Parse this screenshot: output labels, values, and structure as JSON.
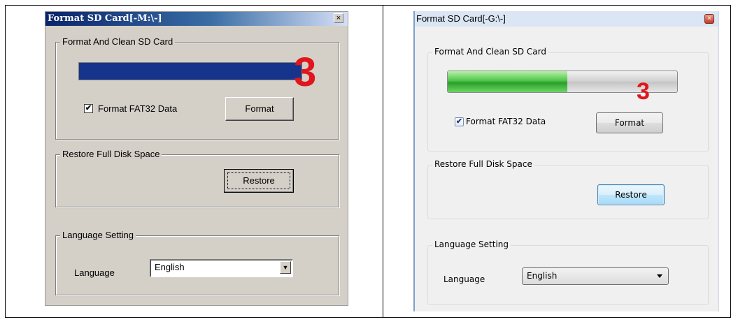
{
  "left_window": {
    "title": "Format SD Card[-M:\\-]",
    "close_glyph": "×",
    "format_group": {
      "legend": "Format And Clean SD Card",
      "progress": 1.0,
      "step_number": "3",
      "checkbox_checked": true,
      "checkbox_label": "Format FAT32 Data",
      "format_button": "Format"
    },
    "restore_group": {
      "legend": "Restore Full Disk Space",
      "restore_button": "Restore"
    },
    "language_group": {
      "legend": "Language Setting",
      "language_label": "Language",
      "language_value": "English"
    }
  },
  "right_window": {
    "title": "Format SD Card[-G:\\-]",
    "close_glyph": "×",
    "format_group": {
      "legend": "Format And Clean SD Card",
      "progress": 0.52,
      "step_number": "3",
      "checkbox_checked": true,
      "checkbox_label": "Format FAT32 Data",
      "format_button": "Format"
    },
    "restore_group": {
      "legend": "Restore Full Disk Space",
      "restore_button": "Restore"
    },
    "language_group": {
      "legend": "Language Setting",
      "language_label": "Language",
      "language_value": "English"
    }
  },
  "colors": {
    "classic_progress": "#16348b",
    "modern_progress": "#4fc64a",
    "step_number": "#e0161c"
  }
}
